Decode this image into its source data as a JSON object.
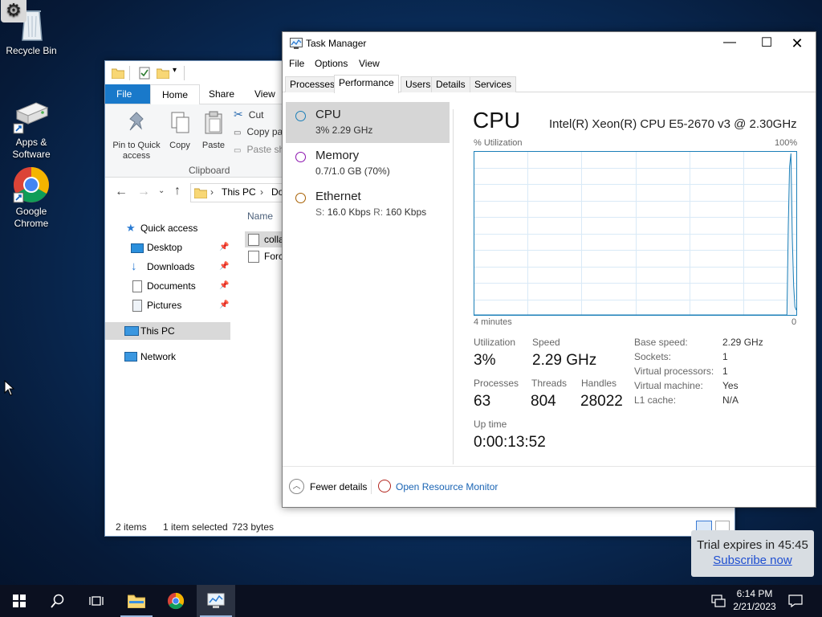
{
  "desktop": {
    "icons": [
      {
        "label": "Recycle Bin"
      },
      {
        "label": "Apps & Software"
      },
      {
        "label": "Google Chrome"
      }
    ]
  },
  "explorer": {
    "ribbon_tabs": [
      "File",
      "Home",
      "Share",
      "View"
    ],
    "clipboard": {
      "pin_label": "Pin to Quick access",
      "copy_label": "Copy",
      "paste_label": "Paste",
      "cut_label": "Cut",
      "copy_path_label": "Copy pa",
      "paste_shortcut_label": "Paste sh",
      "group_label": "Clipboard"
    },
    "address": {
      "segments": [
        "This PC",
        "Do"
      ]
    },
    "nav": {
      "quick_access": "Quick access",
      "items": [
        {
          "label": "Desktop"
        },
        {
          "label": "Downloads"
        },
        {
          "label": "Documents"
        },
        {
          "label": "Pictures"
        }
      ],
      "this_pc": "This PC",
      "network": "Network"
    },
    "content": {
      "column_name": "Name",
      "files": [
        {
          "name": "colla"
        },
        {
          "name": "Forc"
        }
      ]
    },
    "status": {
      "items": "2 items",
      "selected": "1 item selected",
      "size": "723 bytes"
    }
  },
  "taskmgr": {
    "title": "Task Manager",
    "menu": [
      "File",
      "Options",
      "View"
    ],
    "tabs": [
      "Processes",
      "Performance",
      "Users",
      "Details",
      "Services"
    ],
    "sidebar": [
      {
        "name": "CPU",
        "sub": "3%  2.29 GHz",
        "color": "#1b7fb8"
      },
      {
        "name": "Memory",
        "sub": "0.7/1.0 GB (70%)",
        "color": "#8b12ae"
      },
      {
        "name": "Ethernet",
        "sub_s_label": "S:",
        "sub_s": "16.0 Kbps",
        "sub_r_label": "R:",
        "sub_r": "160 Kbps",
        "color": "#a75f00"
      }
    ],
    "main": {
      "heading": "CPU",
      "model": "Intel(R) Xeon(R) CPU E5-2670 v3 @ 2.30GHz",
      "util_label": "% Utilization",
      "util_max": "100%",
      "time_span": "4 minutes",
      "time_zero": "0",
      "utilization_label": "Utilization",
      "utilization": "3%",
      "speed_label": "Speed",
      "speed": "2.29 GHz",
      "processes_label": "Processes",
      "processes": "63",
      "threads_label": "Threads",
      "threads": "804",
      "handles_label": "Handles",
      "handles": "28022",
      "uptime_label": "Up time",
      "uptime": "0:00:13:52",
      "specs": [
        {
          "k": "Base speed:",
          "v": "2.29 GHz"
        },
        {
          "k": "Sockets:",
          "v": "1"
        },
        {
          "k": "Virtual processors:",
          "v": "1"
        },
        {
          "k": "Virtual machine:",
          "v": "Yes"
        },
        {
          "k": "L1 cache:",
          "v": "N/A"
        }
      ]
    },
    "footer": {
      "fewer": "Fewer details",
      "monitor": "Open Resource Monitor"
    },
    "graph_series": [
      0,
      0,
      0,
      0,
      0,
      0,
      0,
      0,
      0,
      0,
      0,
      0,
      0,
      0,
      0,
      0,
      0,
      0,
      0,
      0,
      0,
      0,
      0,
      0,
      0,
      0,
      0,
      0,
      0,
      0,
      0,
      0,
      0,
      0,
      0,
      0,
      0,
      0,
      0,
      0,
      0,
      0,
      0,
      0,
      0,
      0,
      0,
      0,
      0,
      0,
      0,
      0,
      0,
      0,
      0,
      0,
      0,
      0,
      0,
      0,
      0,
      0,
      0,
      0,
      0,
      0,
      0,
      0,
      0,
      0,
      0,
      0,
      0,
      0,
      0,
      0,
      0,
      0,
      0,
      0,
      0,
      0,
      0,
      0,
      0,
      0,
      0,
      0,
      0,
      0,
      0,
      0,
      0,
      0,
      0,
      0,
      0,
      0,
      0,
      0,
      0,
      0,
      0,
      0,
      0,
      0,
      0,
      0,
      0,
      0,
      0,
      0,
      0,
      0,
      0,
      0,
      0,
      0,
      0,
      0,
      0,
      0,
      0,
      0,
      0,
      0,
      0,
      0,
      0,
      0,
      0,
      0,
      0,
      0,
      0,
      0,
      0,
      0,
      0,
      0,
      0,
      0,
      0,
      0,
      0,
      0,
      0,
      0,
      0,
      0,
      0,
      0,
      0,
      0,
      0,
      0,
      0,
      0,
      0,
      0,
      0,
      0,
      0,
      0,
      0,
      0,
      0,
      0,
      0,
      0,
      0,
      0,
      0,
      0,
      0,
      0,
      0,
      0,
      0,
      0,
      0,
      0,
      0,
      0,
      0,
      0,
      0,
      0,
      0,
      0,
      0,
      0,
      0,
      0,
      0,
      0,
      0,
      0,
      0,
      0,
      0,
      0,
      0,
      0,
      0,
      0,
      0,
      0,
      0,
      0,
      0,
      0,
      0,
      0,
      0,
      0,
      0,
      0,
      0,
      0,
      0,
      0,
      0,
      0,
      0,
      0,
      0,
      0,
      0,
      0,
      0,
      0,
      0,
      0,
      55,
      92,
      100,
      48,
      18,
      5,
      3
    ]
  },
  "trial": {
    "text": "Trial expires in 45:45",
    "link": "Subscribe now"
  },
  "taskbar": {
    "time": "6:14 PM",
    "date": "2/21/2023"
  }
}
